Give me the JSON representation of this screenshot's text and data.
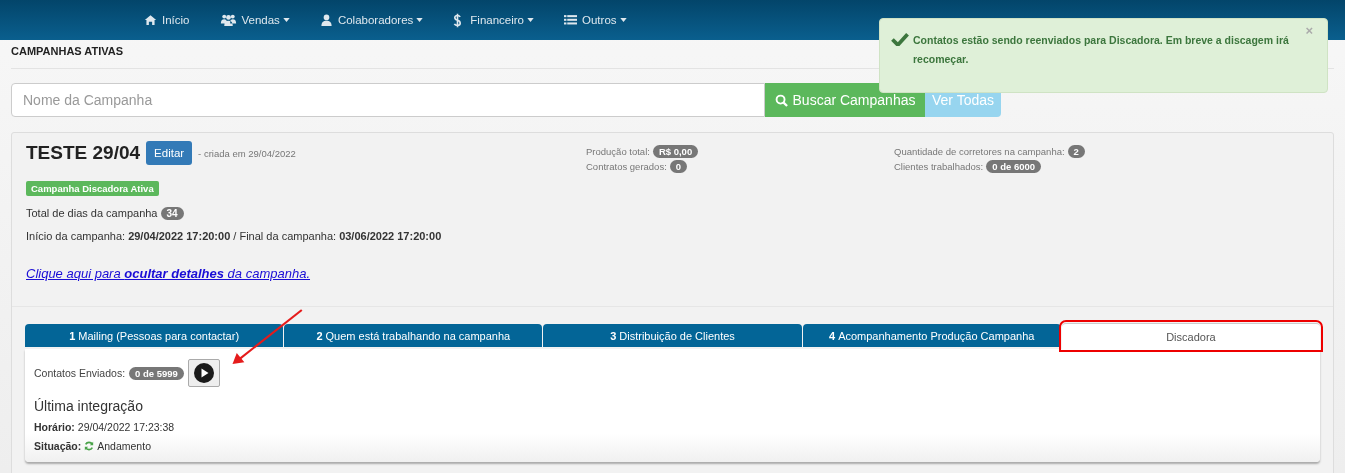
{
  "navbar": {
    "items": [
      {
        "kind": "home",
        "label": "Início",
        "dropdown": false
      },
      {
        "kind": "users",
        "label": "Vendas",
        "dropdown": true
      },
      {
        "kind": "user",
        "label": "Colaboradores",
        "dropdown": true
      },
      {
        "kind": "money",
        "label": "Financeiro",
        "dropdown": true
      },
      {
        "kind": "list",
        "label": "Outros",
        "dropdown": true
      }
    ]
  },
  "page_title": "CAMPANHAS ATIVAS",
  "search": {
    "placeholder": "Nome da Campanha",
    "search_button": "Buscar Campanhas",
    "all_button": "Ver Todas"
  },
  "toast": {
    "message": "Contatos estão sendo reenviados para Discadora. Em breve a discagem irá recomeçar.",
    "close": "×"
  },
  "campaign": {
    "name": "TESTE 29/04",
    "edit_button": "Editar",
    "created": "- criada em 29/04/2022",
    "status_label": "Campanha Discadora Ativa",
    "stats": [
      {
        "label": "Produção total:",
        "value": "R$ 0,00"
      },
      {
        "label": "Contratos gerados:",
        "value": "0"
      },
      {
        "label": "Quantidade de corretores na campanha:",
        "value": "2"
      },
      {
        "label": "Clientes trabalhados:",
        "value": "0 de 6000"
      }
    ],
    "days_label": "Total de dias da campanha",
    "days": "34",
    "dates": "Início da campanha: **29/04/2022 17:20:00** / Final da campanha: **03/06/2022 17:20:00**",
    "toggle_link": "Clique aqui para **ocultar detalhes** da campanha."
  },
  "tabs": [
    {
      "number": "1",
      "label": "Mailing (Pessoas para contactar)",
      "selected": false,
      "highlighted": false
    },
    {
      "number": "2",
      "label": "Quem está trabalhando na campanha",
      "selected": false,
      "highlighted": false
    },
    {
      "number": "3",
      "label": "Distribuição de Clientes",
      "selected": false,
      "highlighted": false
    },
    {
      "number": "4",
      "label": "Acompanhamento Produção Campanha",
      "selected": false,
      "highlighted": false
    },
    {
      "label": "Discadora",
      "selected": true,
      "highlighted": true
    }
  ],
  "panel": {
    "sent_label": "Contatos Enviados:",
    "sent_value": "0 de 5999",
    "heading": "Última integração",
    "time_label": "Horário:",
    "time_value": "29/04/2022 17:23:38",
    "status_label": "Situação:",
    "status_value": "Andamento"
  }
}
